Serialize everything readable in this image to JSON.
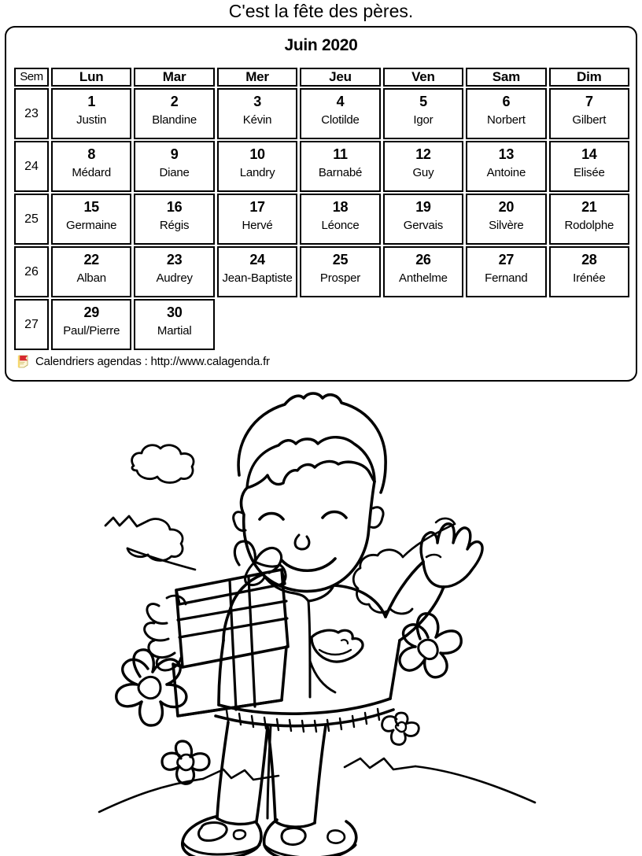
{
  "page": {
    "title": "C'est la fête des pères."
  },
  "calendar": {
    "month_title": "Juin 2020",
    "headers": {
      "week": "Sem",
      "days": [
        "Lun",
        "Mar",
        "Mer",
        "Jeu",
        "Ven",
        "Sam",
        "Dim"
      ]
    },
    "weeks": [
      {
        "week_number": "23",
        "days": [
          {
            "num": "1",
            "saint": "Justin"
          },
          {
            "num": "2",
            "saint": "Blandine"
          },
          {
            "num": "3",
            "saint": "Kévin"
          },
          {
            "num": "4",
            "saint": "Clotilde"
          },
          {
            "num": "5",
            "saint": "Igor"
          },
          {
            "num": "6",
            "saint": "Norbert"
          },
          {
            "num": "7",
            "saint": "Gilbert"
          }
        ]
      },
      {
        "week_number": "24",
        "days": [
          {
            "num": "8",
            "saint": "Médard"
          },
          {
            "num": "9",
            "saint": "Diane"
          },
          {
            "num": "10",
            "saint": "Landry"
          },
          {
            "num": "11",
            "saint": "Barnabé"
          },
          {
            "num": "12",
            "saint": "Guy"
          },
          {
            "num": "13",
            "saint": "Antoine"
          },
          {
            "num": "14",
            "saint": "Elisée"
          }
        ]
      },
      {
        "week_number": "25",
        "days": [
          {
            "num": "15",
            "saint": "Germaine"
          },
          {
            "num": "16",
            "saint": "Régis"
          },
          {
            "num": "17",
            "saint": "Hervé"
          },
          {
            "num": "18",
            "saint": "Léonce"
          },
          {
            "num": "19",
            "saint": "Gervais"
          },
          {
            "num": "20",
            "saint": "Silvère"
          },
          {
            "num": "21",
            "saint": "Rodolphe"
          }
        ]
      },
      {
        "week_number": "26",
        "days": [
          {
            "num": "22",
            "saint": "Alban"
          },
          {
            "num": "23",
            "saint": "Audrey"
          },
          {
            "num": "24",
            "saint": "Jean-Baptiste"
          },
          {
            "num": "25",
            "saint": "Prosper"
          },
          {
            "num": "26",
            "saint": "Anthelme"
          },
          {
            "num": "27",
            "saint": "Fernand"
          },
          {
            "num": "28",
            "saint": "Irénée"
          }
        ]
      },
      {
        "week_number": "27",
        "days": [
          {
            "num": "29",
            "saint": "Paul/Pierre"
          },
          {
            "num": "30",
            "saint": "Martial"
          },
          null,
          null,
          null,
          null,
          null
        ]
      }
    ],
    "footer": {
      "icon": "flag-bookmark-icon",
      "text": "Calendriers agendas : http://www.calagenda.fr"
    }
  },
  "illustration": {
    "name": "boy-with-gift-waving-coloring-page",
    "description": "Line-art coloring illustration: a boy holding a wrapped gift with a bow in one arm and waving with the other, standing on a grassy hill with flowers, clouds and bushes."
  },
  "colors": {
    "ink": "#000000",
    "paper": "#ffffff",
    "flag_red": "#d7282f",
    "flag_yellow": "#f5d76e",
    "flag_page": "#fdf6d8"
  }
}
